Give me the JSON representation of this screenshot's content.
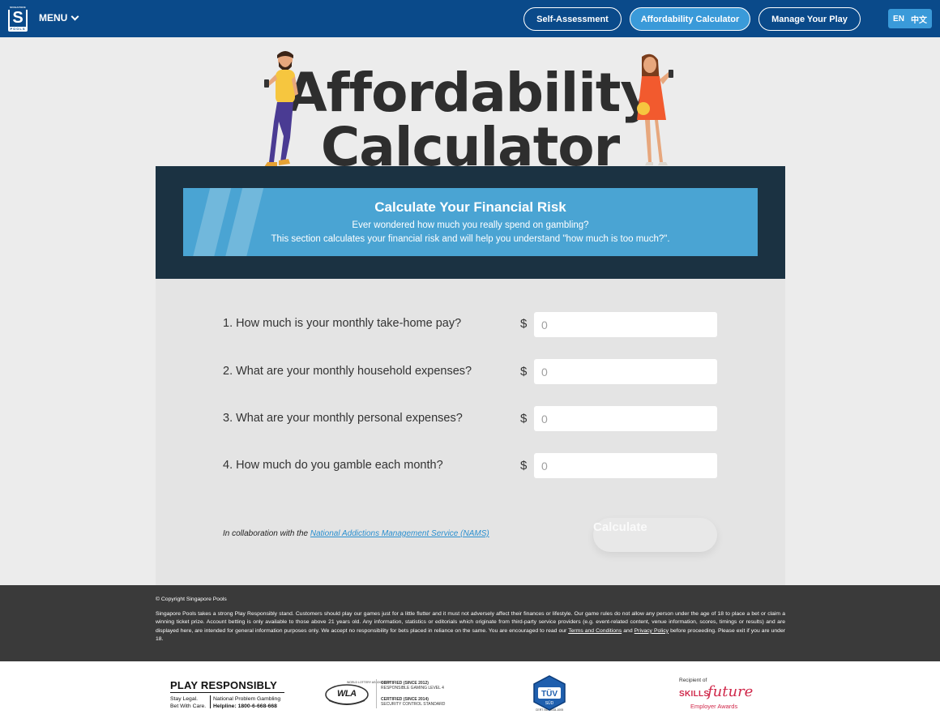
{
  "header": {
    "logo_top": "SINGAPORE",
    "logo_letter": "S",
    "logo_bottom": "POOLS",
    "menu_label": "MENU",
    "nav": [
      {
        "label": "Self-Assessment",
        "active": false
      },
      {
        "label": "Affordability Calculator",
        "active": true
      },
      {
        "label": "Manage Your Play",
        "active": false
      }
    ],
    "lang_en": "EN",
    "lang_zh": "中文"
  },
  "hero": {
    "line1": "Affordability",
    "line2": "Calculator"
  },
  "banner": {
    "title": "Calculate Your Financial Risk",
    "line1": "Ever wondered how much you really spend on gambling?",
    "line2": "This section calculates your financial risk and will help you understand \"how much is too much?\"."
  },
  "form": {
    "currency": "$",
    "questions": [
      {
        "label": "1. How much is your monthly take-home pay?",
        "placeholder": "0"
      },
      {
        "label": "2. What are your monthly household expenses?",
        "placeholder": "0"
      },
      {
        "label": "3. What are your monthly personal expenses?",
        "placeholder": "0"
      },
      {
        "label": "4. How much do you gamble each month?",
        "placeholder": "0"
      }
    ],
    "collab_prefix": "In collaboration with the",
    "collab_link": "National Addictions Management Service (NAMS)",
    "calculate_label": "Calculate"
  },
  "footer": {
    "copyright": "© Copyright Singapore Pools",
    "disclaimer": "Singapore Pools takes a strong Play Responsibly stand. Customers should play our games just for a little flutter and it must not adversely affect their finances or lifestyle. Our game rules do not allow any person under the age of 18 to place a bet or claim a winning ticket prize. Account betting is only available to those above 21 years old. Any information, statistics or editorials which originate from third-party service providers (e.g. event-related content, venue information, scores, timings or results) and are displayed here, are intended for general information purposes only. We accept no responsibility for bets placed in reliance on the same. You are encouraged to read our",
    "terms_link": "Terms and Conditions",
    "and_text": "and",
    "privacy_link": "Privacy Policy",
    "end_text": "before proceeding. Please exit if you are under 18."
  },
  "logos": {
    "play_responsibly": "PLAY RESPONSIBLY",
    "stay_legal": "Stay Legal.",
    "bet_with_care": "Bet With Care.",
    "npg": "National Problem Gambling",
    "helpline": "Helpline: 1800-6-668-668",
    "wla_name": "WLA",
    "wla_assoc": "WORLD LOTTERY ASSOCIATION",
    "wla_cert1_title": "CERTIFIED (SINCE 2012)",
    "wla_cert1_desc": "RESPONSIBLE GAMING LEVEL 4",
    "wla_cert2_title": "CERTIFIED (SINCE 2014)",
    "wla_cert2_desc": "SECURITY CONTROL STANDARD",
    "tuv_name": "TÜV",
    "tuv_sub": "SÜD",
    "tuv_cert": "CERT NO. 2018-1005",
    "sf_recipient": "Recipient of",
    "sf_skills": "SKILLS",
    "sf_future": "future",
    "sf_employer": "Employer Awards"
  },
  "colors": {
    "nav_bg": "#0a4a8a",
    "accent": "#3a9ad9",
    "dark_panel": "#1b3242",
    "banner": "#4aa4d3",
    "footer_dark": "#3a3a3a",
    "skillsfuture": "#d0284a"
  }
}
